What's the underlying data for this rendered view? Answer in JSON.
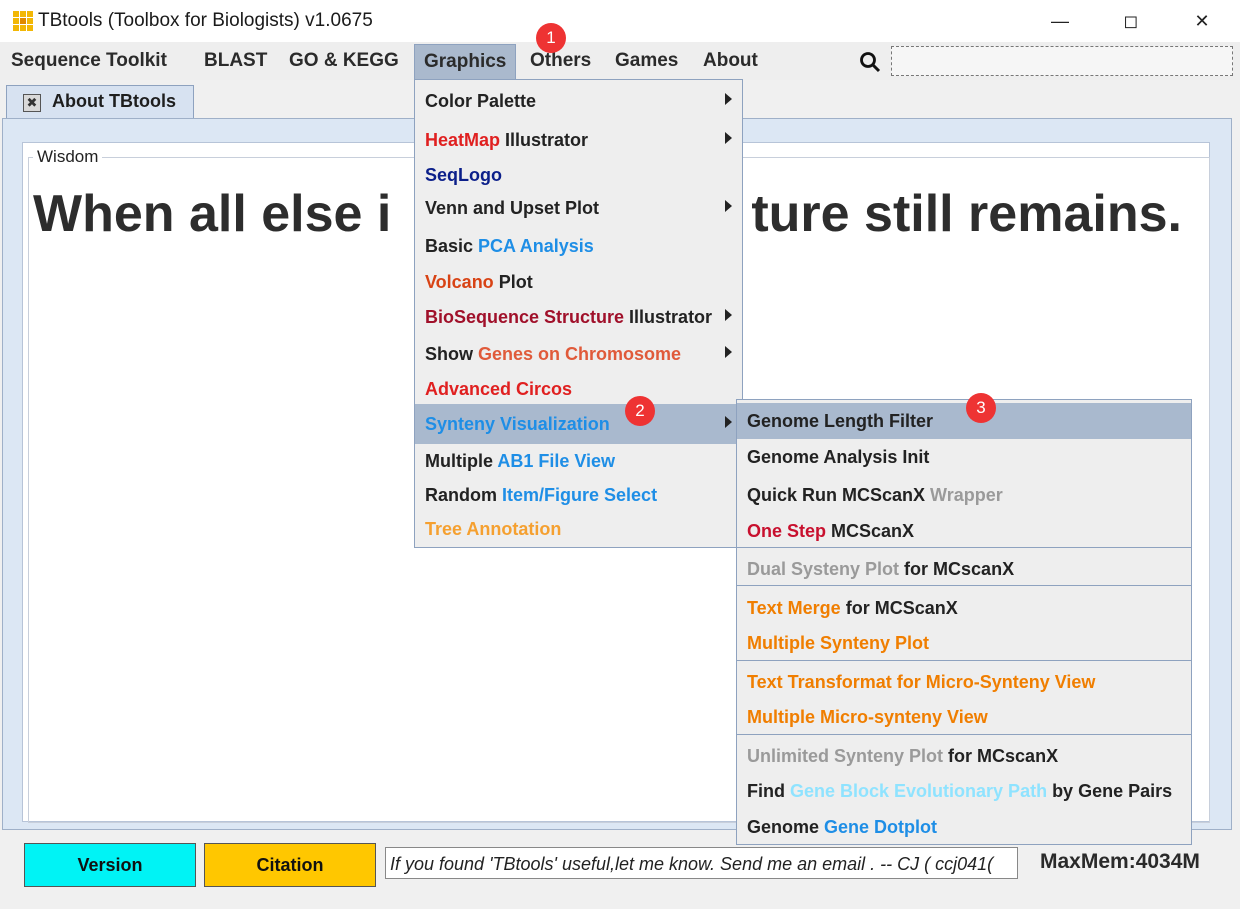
{
  "window": {
    "title": "TBtools (Toolbox for Biologists) v1.0675"
  },
  "menubar": {
    "items": [
      "Sequence Toolkit",
      "BLAST",
      "GO & KEGG",
      "Graphics",
      "Others",
      "Games",
      "About"
    ]
  },
  "tab": {
    "label": "About TBtools"
  },
  "wisdom": {
    "label": "Wisdom",
    "text_left": "When all else i",
    "text_right": "ture still remains."
  },
  "graphics_menu": {
    "items": [
      [
        {
          "t": "Color Palette",
          "c": "#222222"
        }
      ],
      [
        {
          "t": "HeatMap",
          "c": "#e02020"
        },
        {
          "t": " Illustrator",
          "c": "#222222"
        }
      ],
      [
        {
          "t": "SeqLogo",
          "c": "#0b1f8a"
        }
      ],
      [
        {
          "t": "Venn and Upset Plot",
          "c": "#222222"
        }
      ],
      [
        {
          "t": "Basic ",
          "c": "#222222"
        },
        {
          "t": "PCA Analysis",
          "c": "#1e8ee6"
        }
      ],
      [
        {
          "t": "Volcano",
          "c": "#d84315"
        },
        {
          "t": " Plot",
          "c": "#222222"
        }
      ],
      [
        {
          "t": "BioSequence Structure",
          "c": "#a0102a"
        },
        {
          "t": " Illustrator",
          "c": "#222222"
        }
      ],
      [
        {
          "t": "Show ",
          "c": "#222222"
        },
        {
          "t": "Genes on Chromosome",
          "c": "#e05a3a"
        }
      ],
      [
        {
          "t": "Advanced Circos",
          "c": "#e02020"
        }
      ],
      [
        {
          "t": "Synteny Visualization",
          "c": "#1e8ee6"
        }
      ],
      [
        {
          "t": "Multiple ",
          "c": "#222222"
        },
        {
          "t": "AB1 File View",
          "c": "#1e8ee6"
        }
      ],
      [
        {
          "t": "Random ",
          "c": "#222222"
        },
        {
          "t": "Item/Figure Select",
          "c": "#1e8ee6"
        }
      ],
      [
        {
          "t": "Tree Annotation",
          "c": "#f5a030"
        }
      ]
    ]
  },
  "synteny_menu": {
    "items": [
      [
        {
          "t": "Genome Length Filter",
          "c": "#222222"
        }
      ],
      [
        {
          "t": "Genome Analysis Init",
          "c": "#222222"
        }
      ],
      [
        {
          "t": "Quick Run MCScanX ",
          "c": "#222222"
        },
        {
          "t": "Wrapper",
          "c": "#9a9a9a"
        }
      ],
      [
        {
          "t": "One Step",
          "c": "#c8102e"
        },
        {
          "t": " MCScanX",
          "c": "#222222"
        }
      ],
      [
        {
          "t": "Dual Systeny Plot",
          "c": "#9a9a9a"
        },
        {
          "t": " for MCscanX",
          "c": "#222222"
        }
      ],
      [
        {
          "t": "Text Merge",
          "c": "#f07e00"
        },
        {
          "t": " for MCScanX",
          "c": "#222222"
        }
      ],
      [
        {
          "t": "Multiple Synteny Plot",
          "c": "#f07e00"
        }
      ],
      [
        {
          "t": "Text Transformat for Micro-Synteny View",
          "c": "#f07e00"
        }
      ],
      [
        {
          "t": "Multiple Micro-synteny View",
          "c": "#f07e00"
        }
      ],
      [
        {
          "t": "Unlimited ",
          "c": "#9a9a9a"
        },
        {
          "t": "Synteny Plot",
          "c": "#9a9a9a"
        },
        {
          "t": " for MCscanX",
          "c": "#222222"
        }
      ],
      [
        {
          "t": "Find ",
          "c": "#222222"
        },
        {
          "t": "Gene Block Evolutionary Path",
          "c": "#8fe3ff"
        },
        {
          "t": " by Gene Pairs",
          "c": "#222222"
        }
      ],
      [
        {
          "t": "Genome ",
          "c": "#222222"
        },
        {
          "t": "Gene Dotplot",
          "c": "#1e8ee6"
        }
      ]
    ]
  },
  "badges": [
    "1",
    "2",
    "3"
  ],
  "bottom": {
    "version_label": "Version",
    "citation_label": "Citation",
    "message": "If you found 'TBtools' useful,let me know. Send me an email . -- CJ   ( ccj041(",
    "maxmem": "MaxMem:4034M"
  },
  "colors": {
    "accent_highlight": "#a9b9ce",
    "version_bg": "#00f3f5",
    "citation_bg": "#ffc700",
    "badge": "#ee3333"
  },
  "icons": [
    "app-grid-icon",
    "minimize-icon",
    "maximize-icon",
    "close-icon",
    "search-icon",
    "tab-close-icon",
    "submenu-arrow-icon"
  ]
}
